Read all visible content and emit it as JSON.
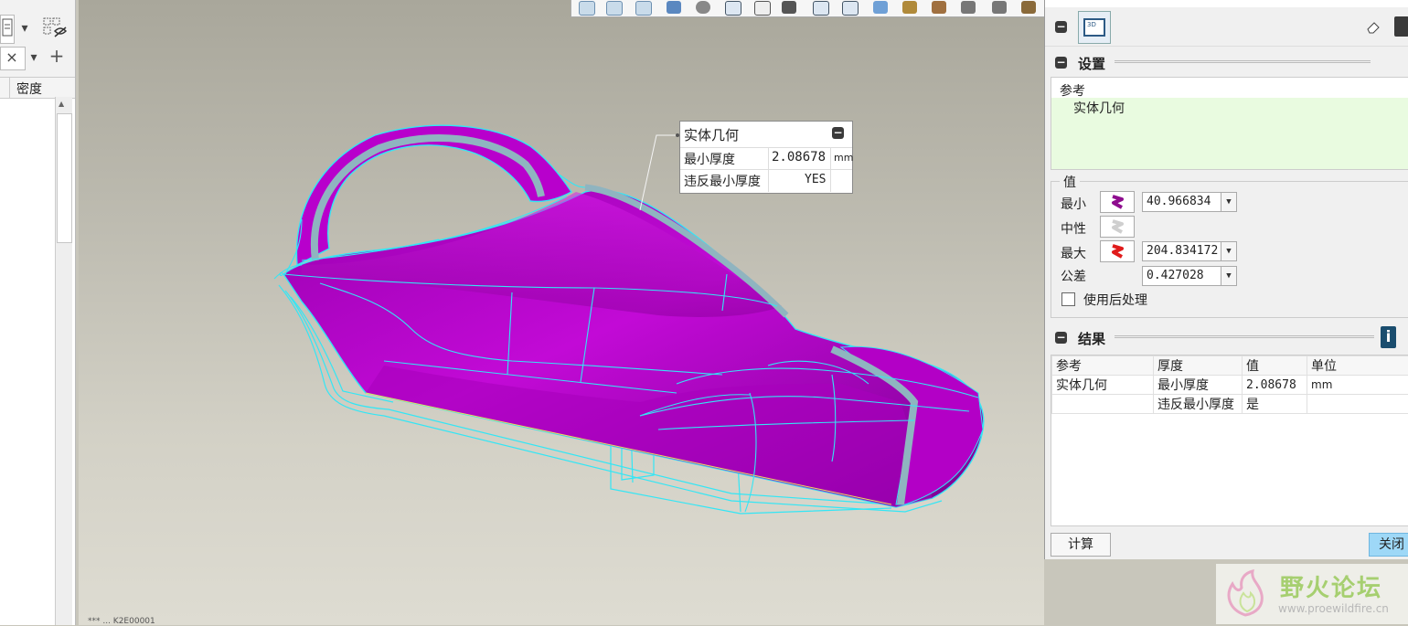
{
  "left_panel": {
    "column_header": "密度",
    "close_symbol": "×",
    "add_symbol": "+",
    "dropdown_symbol": "▾"
  },
  "viewport": {
    "status_text": "*** ... K2E00001"
  },
  "callout": {
    "title": "实体几何",
    "rows": [
      {
        "label": "最小厚度",
        "value": "2.08678",
        "unit": "mm"
      },
      {
        "label": "违反最小厚度",
        "value": "YES",
        "unit": ""
      }
    ]
  },
  "right_panel": {
    "settings": {
      "title": "设置",
      "reference_label": "参考",
      "reference_item": "实体几何"
    },
    "values": {
      "title": "值",
      "min_label": "最小",
      "min_value": "40.966834",
      "neutral_label": "中性",
      "max_label": "最大",
      "max_value": "204.834172",
      "tolerance_label": "公差",
      "tolerance_value": "0.427028",
      "postprocess_label": "使用后处理",
      "postprocess_checked": false
    },
    "results": {
      "title": "结果",
      "columns": [
        "参考",
        "厚度",
        "值",
        "单位"
      ],
      "rows": [
        [
          "实体几何",
          "最小厚度",
          "2.08678",
          "mm"
        ],
        [
          "",
          "违反最小厚度",
          "是",
          ""
        ]
      ]
    },
    "compute_button": "计算",
    "close_button": "关闭",
    "info_symbol": "i"
  },
  "watermark": {
    "title": "野火论坛",
    "url": "www.proewildfire.cn"
  },
  "colors": {
    "model_fill": "#b000c8",
    "model_edges": "#33e6f5",
    "accent_blue": "#9ed8f7",
    "info_icon": "#1a4d6e",
    "min_swatch": "#8e0d8e",
    "max_swatch": "#e01b1b"
  }
}
